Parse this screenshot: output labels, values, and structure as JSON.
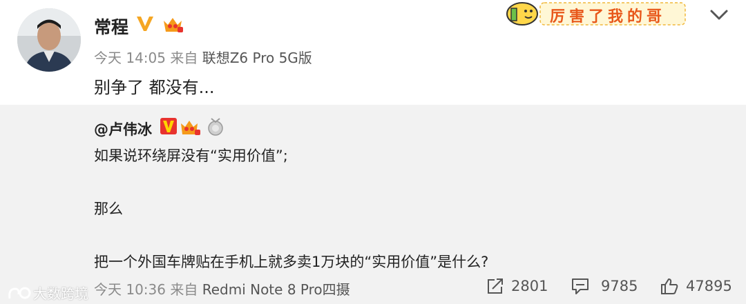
{
  "post": {
    "author": "常程",
    "time": "今天 14:05",
    "source_prefix": "来自",
    "device": "联想Z6 Pro 5G版",
    "text": "别争了 都没有...",
    "sticker_text": "厉害了我的哥"
  },
  "repost": {
    "author": "@卢伟冰",
    "lines": [
      "如果说环绕屏没有“实用价值”;",
      "那么",
      "把一个外国车牌贴在手机上就多卖1万块的“实用价值”是什么?"
    ],
    "time": "今天 10:36",
    "source_prefix": "来自",
    "device": "Redmi Note 8 Pro四摄",
    "reposts": "2801",
    "comments": "9785",
    "likes": "47895"
  },
  "watermark": "大数跨境",
  "colors": {
    "vip_v": "#f5a623",
    "repost_bg": "#f2f2f2",
    "meta": "#8a8a8a"
  }
}
